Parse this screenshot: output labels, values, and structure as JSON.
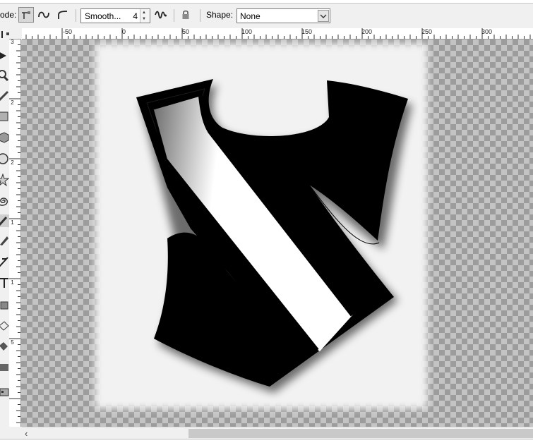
{
  "toolbar": {
    "mode_label": "ode:",
    "smooth_value": "Smooth...",
    "smooth_number": "4",
    "shape_label": "Shape:",
    "shape_value": "None",
    "mode_buttons": [
      "regular-bezier-icon",
      "spiro-path-icon",
      "bspline-path-icon"
    ]
  },
  "ruler": {
    "horizontal_labels": [
      "-50",
      "0",
      "50",
      "100",
      "150",
      "200",
      "250",
      "300"
    ],
    "vertical_labels": [
      "3",
      "2",
      "2",
      "1",
      "1",
      "5"
    ]
  },
  "toolbox": {
    "tools": [
      "node-tool-icon",
      "tweak-tool-icon",
      "zoom-tool-icon",
      "measure-tool-icon",
      "rect-tool-icon",
      "3d-box-tool-icon",
      "ellipse-tool-icon",
      "star-tool-icon",
      "spiral-tool-icon",
      "pencil-tool-icon",
      "pen-tool-icon",
      "calligraphy-tool-icon",
      "text-tool-icon",
      "spray-tool-icon",
      "eraser-tool-icon",
      "bucket-tool-icon",
      "gradient-tool-icon",
      "dropper-tool-icon"
    ]
  },
  "canvas": {
    "artwork": "shield-artwork",
    "colors": {
      "paper": "#f2f2f2",
      "shape": "#000000",
      "checker_dark": "#9c9c9c",
      "checker_light": "#c4c4c4"
    }
  },
  "scrollbar": {
    "left_arrow": "‹"
  }
}
